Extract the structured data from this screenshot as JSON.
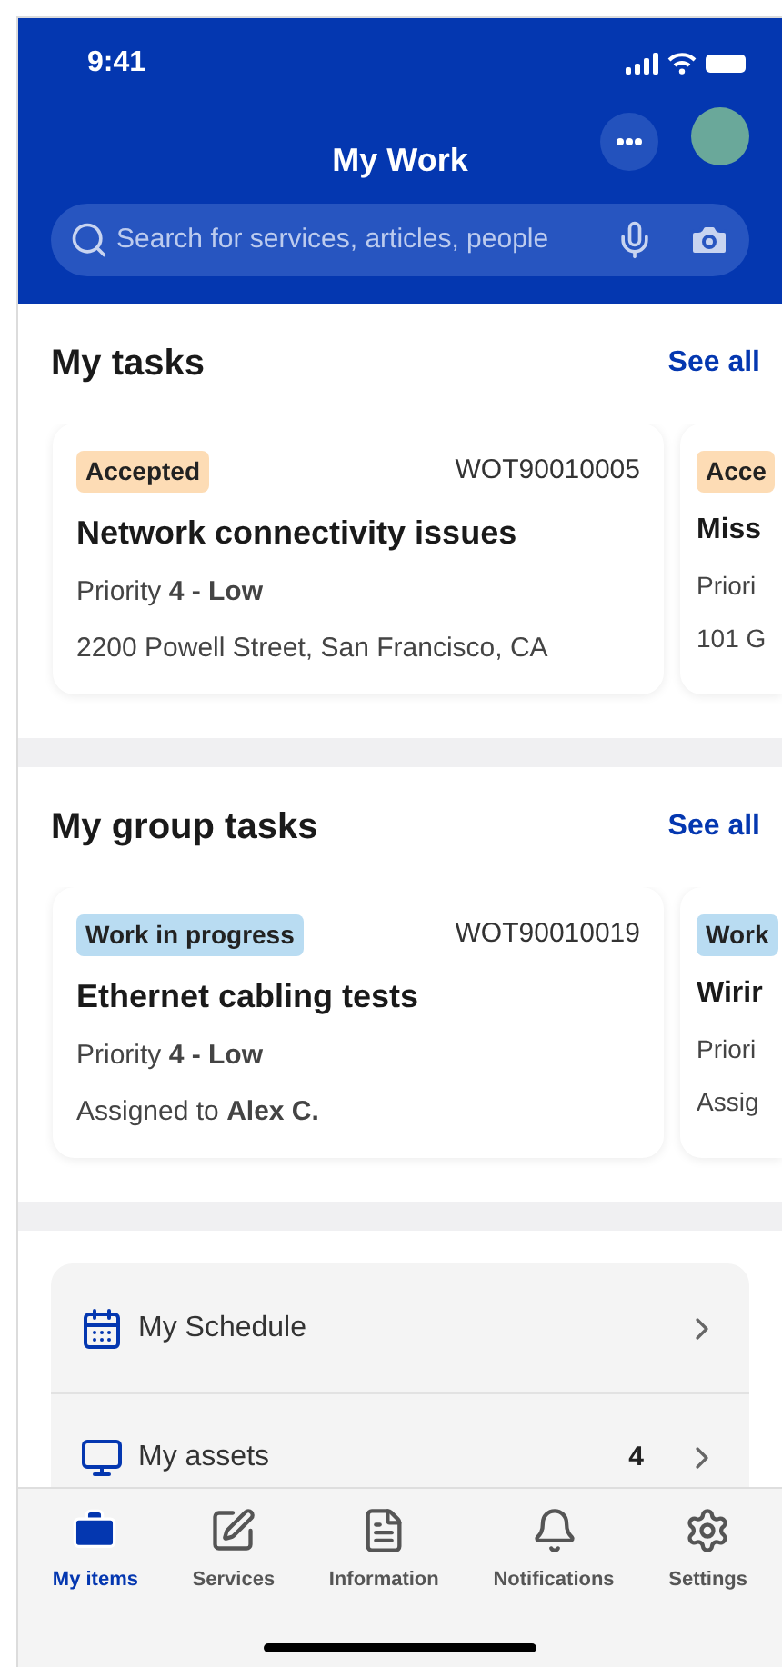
{
  "status_bar": {
    "time": "9:41"
  },
  "header": {
    "title": "My Work",
    "search": {
      "placeholder": "Search for services, articles, people"
    }
  },
  "sections": [
    {
      "title": "My tasks",
      "action": "See all",
      "cards": [
        {
          "status": "Accepted",
          "color": "#fddcb5",
          "id": "WOT90010005",
          "title": "Network connectivity issues",
          "lines": [
            "Priority **4 - Low**",
            "2200 Powell Street, San Francisco, CA"
          ]
        },
        {
          "status": "Acce",
          "color": "#fddcb5",
          "title": "Miss",
          "lines": [
            "Priori",
            "101 G"
          ]
        }
      ]
    },
    {
      "title": "My group tasks",
      "action": "See all",
      "cards": [
        {
          "status": "Work in progress",
          "color": "#b9dcf2",
          "id": "WOT90010019",
          "title": "Ethernet cabling tests",
          "lines": [
            "Priority **4 - Low**",
            "Assigned to **Alex C.**"
          ]
        },
        {
          "status": "Work",
          "color": "#b9dcf2",
          "title": "Wirir",
          "lines": [
            "Priori",
            "Assig"
          ]
        }
      ]
    }
  ],
  "links": [
    {
      "label": "My Schedule"
    },
    {
      "label": "My assets",
      "count": "4"
    }
  ],
  "tab_bar": [
    {
      "label": "My items",
      "selected": true
    },
    {
      "label": "Services",
      "selected": false
    },
    {
      "label": "Information",
      "selected": false
    },
    {
      "label": "Notifications",
      "selected": false
    },
    {
      "label": "Settings",
      "selected": false
    }
  ]
}
